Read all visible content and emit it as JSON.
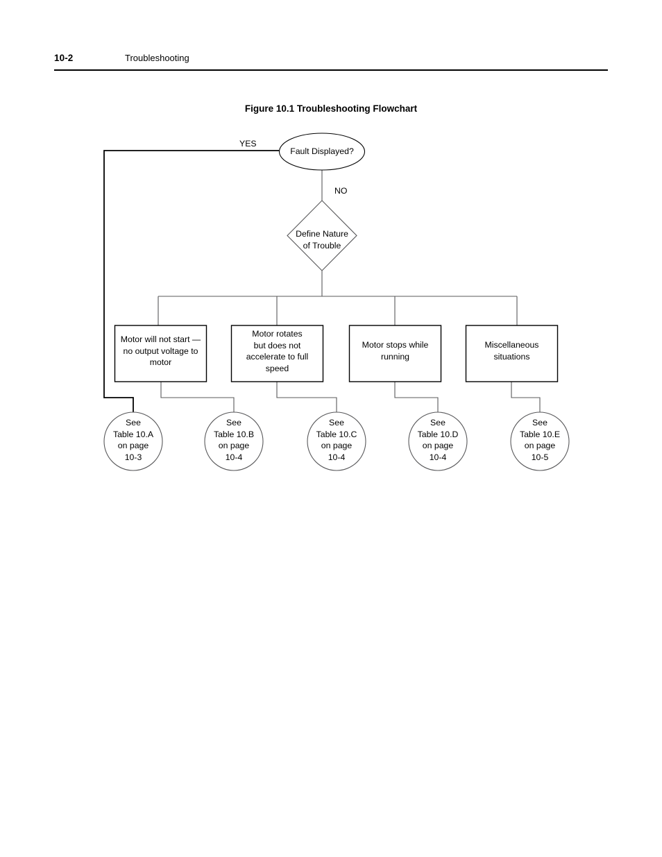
{
  "header": {
    "page_number": "10-2",
    "title": "Troubleshooting"
  },
  "figure": {
    "caption": "Figure 10.1 Troubleshooting Flowchart"
  },
  "flowchart": {
    "start": {
      "shape": "ellipse",
      "label": "Fault Displayed?"
    },
    "decision": {
      "shape": "diamond",
      "label": "Define Nature\nof Trouble"
    },
    "edge_labels": {
      "yes": "YES",
      "no": "NO"
    },
    "problem_boxes": [
      {
        "label": "Motor will not start —\nno output voltage to\nmotor"
      },
      {
        "label": "Motor rotates\nbut does not\naccelerate to full\nspeed"
      },
      {
        "label": "Motor stops while\nrunning"
      },
      {
        "label": "Miscellaneous\nsituations"
      }
    ],
    "reference_circles": [
      {
        "label": "See\nTable 10.A\non page\n10-3"
      },
      {
        "label": "See\nTable 10.B\non page\n10-4"
      },
      {
        "label": "See\nTable 10.C\non page\n10-4"
      },
      {
        "label": "See\nTable 10.D\non page\n10-4"
      },
      {
        "label": "See\nTable 10.E\non page\n10-5"
      }
    ]
  },
  "colors": {
    "ink": "#000000",
    "line": "#58585a",
    "paper": "#ffffff"
  }
}
